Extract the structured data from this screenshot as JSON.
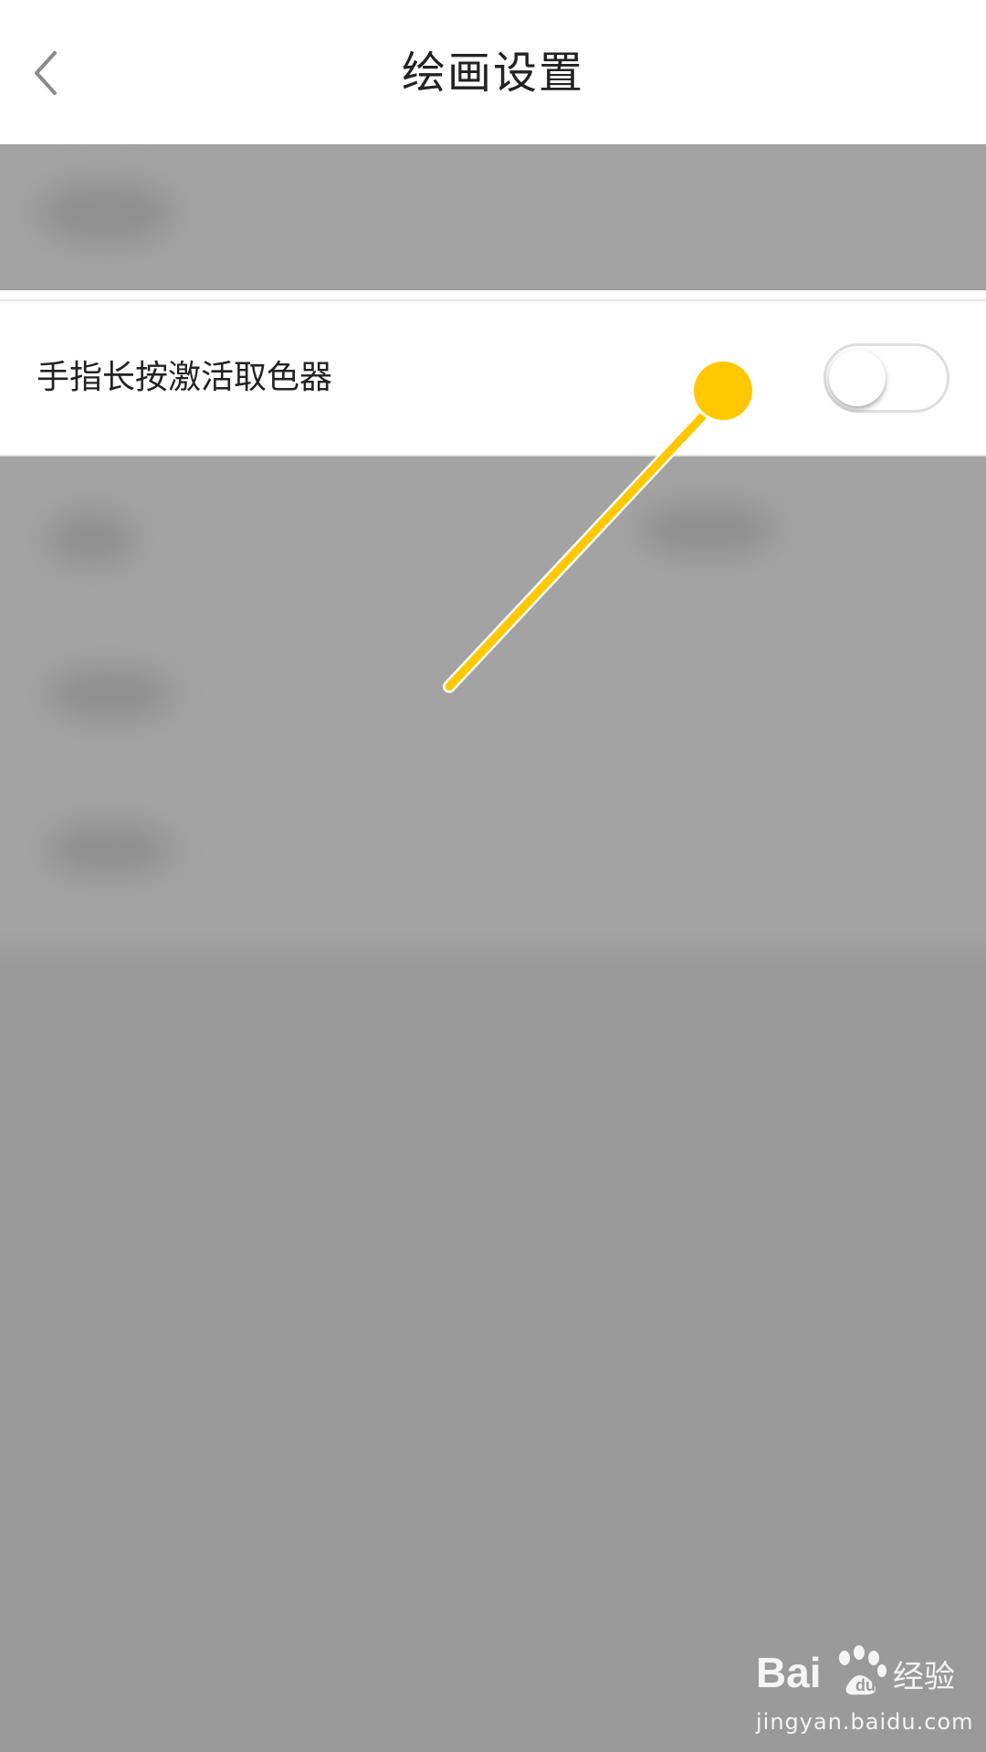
{
  "header": {
    "title": "绘画设置",
    "back_icon": "chevron-left-icon"
  },
  "settings": {
    "color_picker_row": {
      "label": "手指长按激活取色器",
      "toggle_on": false
    }
  },
  "annotation": {
    "color": "#ffc800"
  },
  "watermark": {
    "url": "jingyan.baidu.com"
  },
  "colors": {
    "overlay_gray": "#a3a3a3",
    "overlay_gray_dark": "#9a9a9a",
    "text_primary": "#222222",
    "divider": "#e3e3e3"
  }
}
